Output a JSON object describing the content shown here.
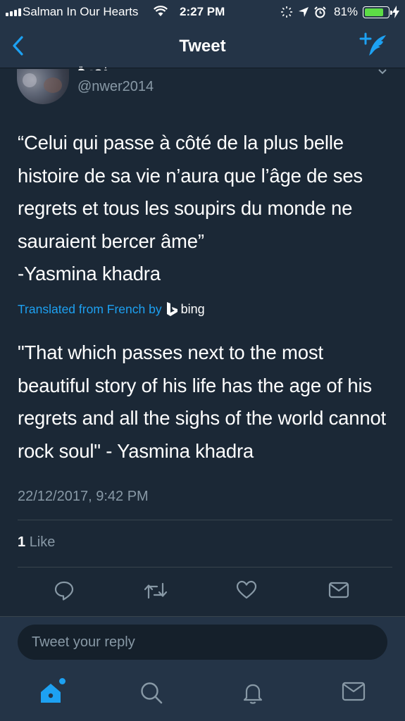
{
  "status_bar": {
    "carrier": "Salman In Our Hearts",
    "time": "2:27 PM",
    "battery_percent": "81%",
    "battery_level": 0.81,
    "icons": [
      "signal-icon",
      "wifi-icon",
      "brightness-icon",
      "location-icon",
      "alarm-icon",
      "battery-icon",
      "charging-icon"
    ]
  },
  "nav": {
    "title": "Tweet",
    "back_icon": "chevron-left-icon",
    "compose_icon": "compose-tweet-icon"
  },
  "tweet": {
    "author_name_partial": "نورة",
    "handle": "@nwer2014",
    "text": "“Celui qui passe à côté de la plus belle\nhistoire de sa vie n’aura que l’âge de ses\nregrets et tous les soupirs du monde ne\nsauraient bercer âme”\n-Yasmina khadra",
    "translated_label": "Translated from French by",
    "translator": "bing",
    "translation": "\"That which passes next to the most beautiful story of his life has the age of his regrets and all the sighs of the world cannot rock soul\" - Yasmina khadra",
    "timestamp": "22/12/2017, 9:42 PM",
    "like_count": "1",
    "like_label": "Like"
  },
  "actions": [
    "reply-icon",
    "retweet-icon",
    "like-icon",
    "share-icon"
  ],
  "reply": {
    "placeholder": "Tweet your reply"
  },
  "tabs": [
    "home-icon",
    "search-icon",
    "notifications-icon",
    "messages-icon"
  ],
  "colors": {
    "background": "#1b2836",
    "bar": "#243447",
    "accent": "#1da1f2",
    "secondary_text": "#8899a6",
    "battery": "#5ddc46"
  }
}
